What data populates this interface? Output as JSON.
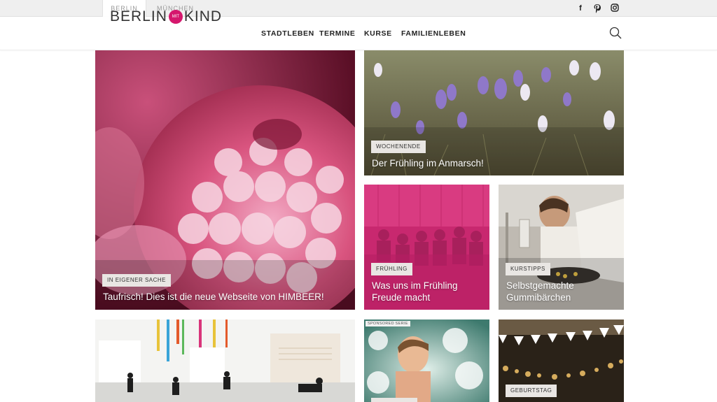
{
  "top_bar": {
    "city_tabs": [
      "BERLIN",
      "MÜNCHEN"
    ],
    "social_icons": [
      "facebook-icon",
      "pinterest-icon",
      "instagram-icon"
    ]
  },
  "header": {
    "logo": {
      "left": "BERLIN",
      "mid": "MIT",
      "right": "KIND"
    },
    "nav": [
      "STADTLEBEN",
      "TERMINE",
      "KURSE",
      "FAMILIENLEBEN"
    ]
  },
  "tiles": [
    {
      "badge": "IN EIGENER SACHE",
      "caption": "Taufrisch! Dies ist die neue Webseite von HIMBEER!"
    },
    {
      "badge": "WOCHENENDE",
      "caption": "Der Frühling im Anmarsch!"
    },
    {
      "badge": "FRÜHLING",
      "caption": "Was uns im Frühling Freude macht"
    },
    {
      "badge": "KURSTIPPS",
      "caption": "Selbstgemachte Gummibärchen"
    },
    {
      "badge": "",
      "caption": ""
    },
    {
      "sponsored": "SPONSORED SERIE",
      "badge": "",
      "caption": ""
    },
    {
      "badge": "GEBURTSTAG",
      "caption": ""
    }
  ],
  "colors": {
    "brand": "#d5176d"
  }
}
